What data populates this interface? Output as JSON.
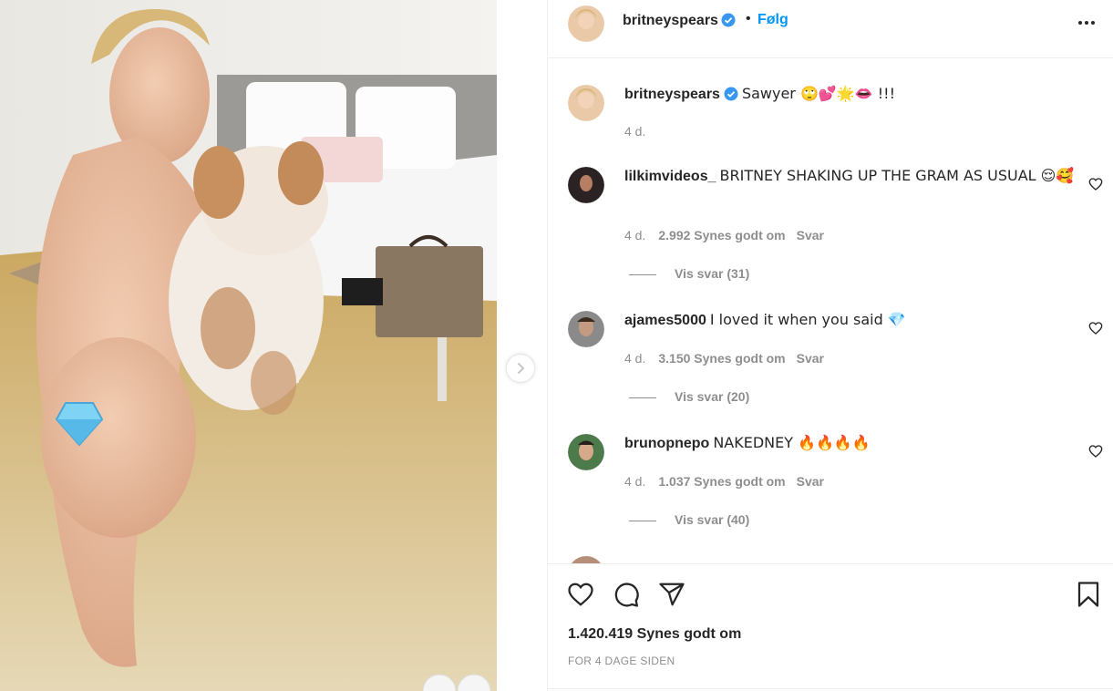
{
  "post": {
    "author": "britneyspears",
    "follow_label": "Følg",
    "separator": "•",
    "caption": "Sawyer 🙄💕🌟👄 !!!",
    "caption_time": "4 d.",
    "likes": "1.420.419 Synes godt om",
    "posted": "FOR 4 DAGE SIDEN"
  },
  "comments": [
    {
      "user": "lilkimvideos_",
      "text": "BRITNEY SHAKING UP THE GRAM AS USUAL 😌🥰",
      "time": "4 d.",
      "likes": "2.992 Synes godt om",
      "reply": "Svar",
      "view_replies": "Vis svar (31)"
    },
    {
      "user": "ajames5000",
      "text": "I loved it when you said 💎",
      "time": "4 d.",
      "likes": "3.150 Synes godt om",
      "reply": "Svar",
      "view_replies": "Vis svar (20)"
    },
    {
      "user": "brunopnepo",
      "text": "NAKEDNEY 🔥🔥🔥🔥",
      "time": "4 d.",
      "likes": "1.037 Synes godt om",
      "reply": "Svar",
      "view_replies": "Vis svar (40)"
    }
  ],
  "icons": {
    "verified": "verified-badge-icon",
    "more": "more-options-icon",
    "next": "chevron-right-icon",
    "like": "heart-icon",
    "comment": "comment-icon",
    "share": "paper-plane-icon",
    "save": "bookmark-icon"
  },
  "colors": {
    "accent": "#0095f6",
    "text": "#262626",
    "muted": "#8e8e8e",
    "verified": "#3897f0"
  }
}
